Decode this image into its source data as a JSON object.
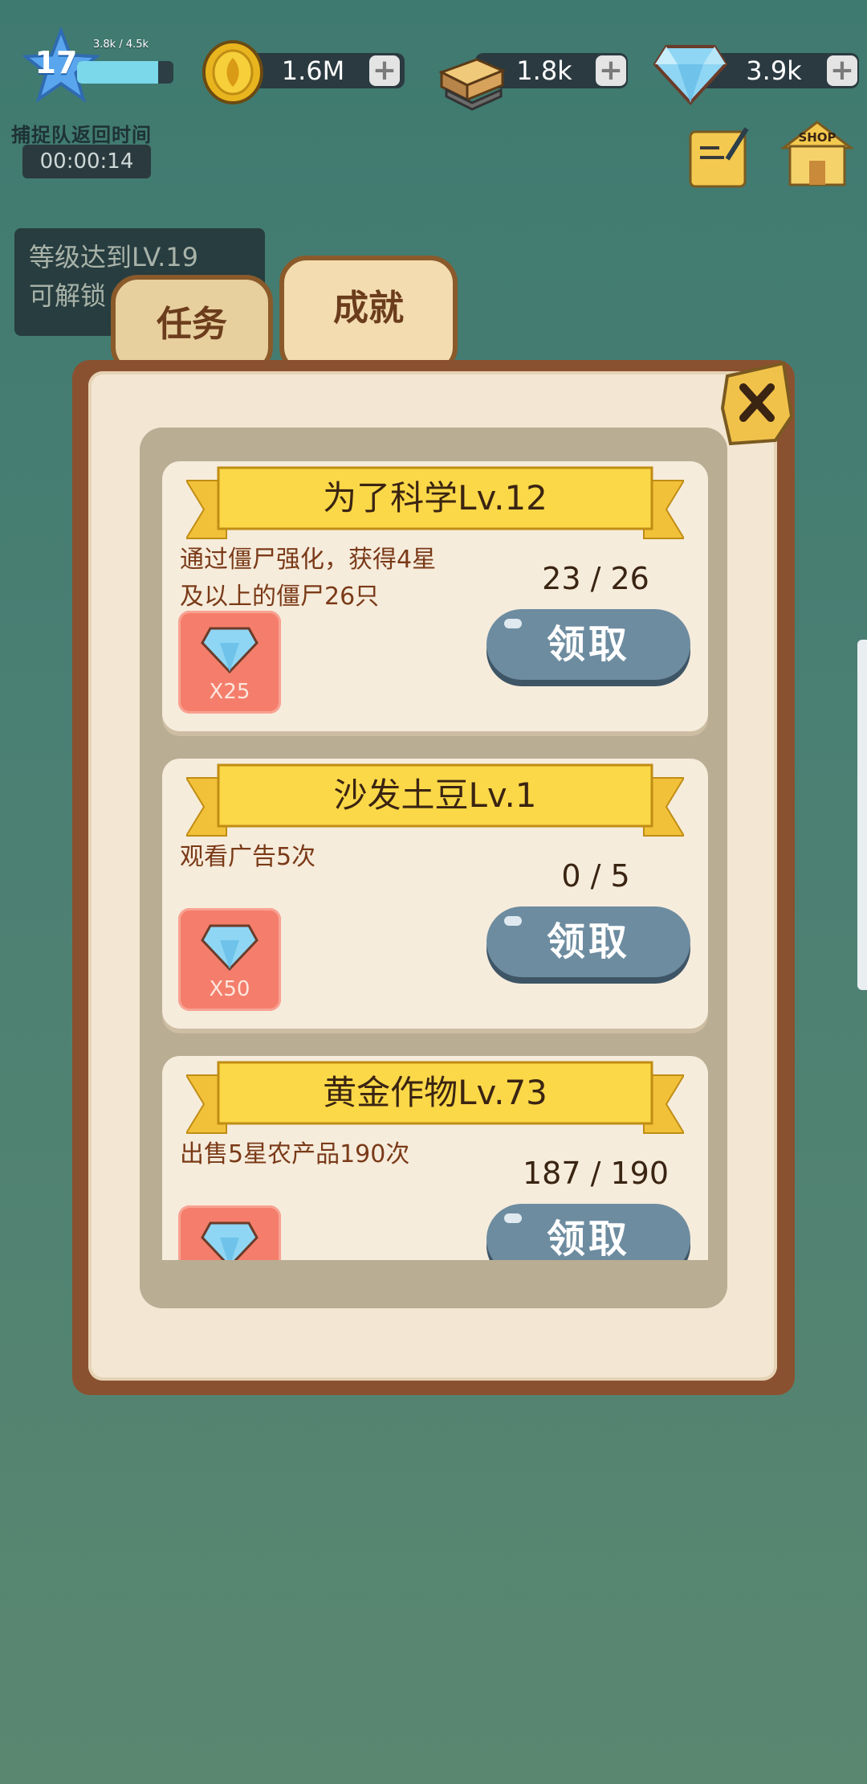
{
  "hud": {
    "level": "17",
    "xp_text": "3.8k / 4.5k",
    "xp_progress": 0.84,
    "coins": "1.6M",
    "wood": "1.8k",
    "gems": "3.9k",
    "plus": "+",
    "capture_label": "捕捉队返回时间",
    "capture_timer": "00:00:14",
    "shop_label": "SHOP"
  },
  "unlock_hint": {
    "line1": "等级达到LV.19",
    "line2": "可解锁"
  },
  "tabs": [
    {
      "label": "任务",
      "active": false
    },
    {
      "label": "成就",
      "active": true
    }
  ],
  "achievements": [
    {
      "title": "为了科学Lv.12",
      "desc_line1": "通过僵尸强化，获得4星",
      "desc_line2": "及以上的僵尸26只",
      "progress": "23 / 26",
      "reward": "X25",
      "claim": "领取"
    },
    {
      "title": "沙发土豆Lv.1",
      "desc_line1": "观看广告5次",
      "desc_line2": "",
      "progress": "0 / 5",
      "reward": "X50",
      "claim": "领取"
    },
    {
      "title": "黄金作物Lv.73",
      "desc_line1": "出售5星农产品190次",
      "desc_line2": "",
      "progress": "187 / 190",
      "reward": "",
      "claim": "领取"
    }
  ],
  "colors": {
    "background": "#4a7f73",
    "board": "#8a5130",
    "card": "#f6ecdc",
    "ribbon": "#fbd848",
    "reward_tile": "#f47e6b",
    "claim_button": "#6d8ca0"
  }
}
